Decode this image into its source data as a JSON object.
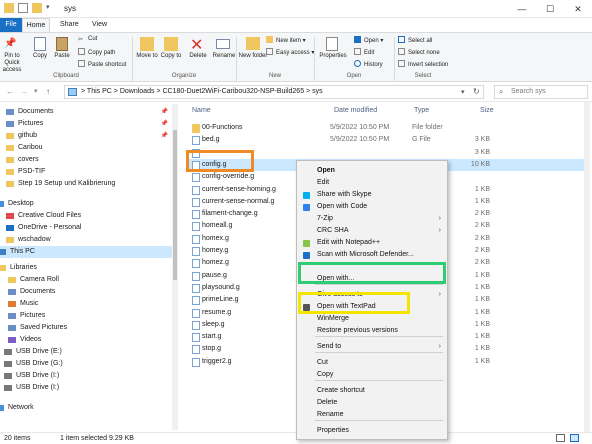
{
  "window": {
    "title": "sys",
    "minimize": "—",
    "maximize": "☐",
    "close": "✕"
  },
  "tabs": {
    "file": "File",
    "home": "Home",
    "share": "Share",
    "view": "View"
  },
  "ribbon": {
    "pin_quick": "Pin to Quick access",
    "copy": "Copy",
    "paste": "Paste",
    "cut": "Cut",
    "copy_path": "Copy path",
    "paste_shortcut": "Paste shortcut",
    "clipboard_group": "Clipboard",
    "move_to": "Move to",
    "copy_to": "Copy to",
    "delete": "Delete",
    "rename": "Rename",
    "organize_group": "Organize",
    "new_folder": "New folder",
    "new_item": "New item",
    "easy_access": "Easy access",
    "new_group": "New",
    "properties": "Properties",
    "open": "Open",
    "edit": "Edit",
    "history": "History",
    "open_group": "Open",
    "select_all": "Select all",
    "select_none": "Select none",
    "invert_selection": "Invert selection",
    "select_group": "Select"
  },
  "address": {
    "crumbs": [
      "This PC",
      "Downloads",
      "CC180-Duet2WiFi-Caribou320-NSP-Build265",
      "sys"
    ],
    "separator": ">",
    "search_placeholder": "Search sys"
  },
  "nav": {
    "items": [
      {
        "label": "Documents",
        "pinned": true
      },
      {
        "label": "Pictures",
        "pinned": true
      },
      {
        "label": "github",
        "pinned": true
      },
      {
        "label": "Caribou",
        "pinned": false
      },
      {
        "label": "covers",
        "pinned": false
      },
      {
        "label": "PSD-TIF",
        "pinned": false
      },
      {
        "label": "Step 19 Setup und Kalibrierung",
        "pinned": false
      },
      {
        "label": "Desktop",
        "pinned": false
      },
      {
        "label": "Creative Cloud Files",
        "pinned": false
      },
      {
        "label": "OneDrive - Personal",
        "pinned": false
      },
      {
        "label": "wschadow",
        "pinned": false
      },
      {
        "label": "This PC",
        "pinned": false
      },
      {
        "label": "Libraries",
        "pinned": false
      },
      {
        "label": "Camera Roll",
        "pinned": false
      },
      {
        "label": "Documents",
        "pinned": false
      },
      {
        "label": "Music",
        "pinned": false
      },
      {
        "label": "Pictures",
        "pinned": false
      },
      {
        "label": "Saved Pictures",
        "pinned": false
      },
      {
        "label": "Videos",
        "pinned": false
      },
      {
        "label": "USB Drive (E:)",
        "pinned": false
      },
      {
        "label": "USB Drive (G:)",
        "pinned": false
      },
      {
        "label": "USB Drive (I:)",
        "pinned": false
      },
      {
        "label": "USB Drive (I:)",
        "pinned": false
      },
      {
        "label": "Network",
        "pinned": false
      }
    ],
    "pin_glyph": "📌"
  },
  "columns": {
    "name": "Name",
    "date": "Date modified",
    "type": "Type",
    "size": "Size"
  },
  "files": [
    {
      "name": "00-Functions",
      "date": "5/9/2022 10:50 PM",
      "type": "File folder",
      "size": "",
      "kind": "folder"
    },
    {
      "name": "bed.g",
      "date": "5/9/2022 10:50 PM",
      "type": "G File",
      "size": "3 KB",
      "kind": "file"
    },
    {
      "name": "",
      "date": "",
      "type": "",
      "size": "3 KB",
      "kind": "file"
    },
    {
      "name": "config.g",
      "date": "",
      "type": "",
      "size": "10 KB",
      "kind": "file"
    },
    {
      "name": "config-override.g",
      "date": "",
      "type": "",
      "size": "",
      "kind": "file"
    },
    {
      "name": "current-sense-homing.g",
      "date": "",
      "type": "",
      "size": "1 KB",
      "kind": "file"
    },
    {
      "name": "current-sense-normal.g",
      "date": "",
      "type": "",
      "size": "1 KB",
      "kind": "file"
    },
    {
      "name": "filament-change.g",
      "date": "",
      "type": "",
      "size": "2 KB",
      "kind": "file"
    },
    {
      "name": "homeall.g",
      "date": "",
      "type": "",
      "size": "2 KB",
      "kind": "file"
    },
    {
      "name": "homex.g",
      "date": "",
      "type": "",
      "size": "2 KB",
      "kind": "file"
    },
    {
      "name": "homey.g",
      "date": "",
      "type": "",
      "size": "2 KB",
      "kind": "file"
    },
    {
      "name": "homez.g",
      "date": "",
      "type": "",
      "size": "2 KB",
      "kind": "file"
    },
    {
      "name": "pause.g",
      "date": "",
      "type": "",
      "size": "1 KB",
      "kind": "file"
    },
    {
      "name": "playsound.g",
      "date": "",
      "type": "",
      "size": "1 KB",
      "kind": "file"
    },
    {
      "name": "primeLine.g",
      "date": "",
      "type": "",
      "size": "1 KB",
      "kind": "file"
    },
    {
      "name": "resume.g",
      "date": "",
      "type": "",
      "size": "1 KB",
      "kind": "file"
    },
    {
      "name": "sleep.g",
      "date": "",
      "type": "",
      "size": "1 KB",
      "kind": "file"
    },
    {
      "name": "start.g",
      "date": "",
      "type": "",
      "size": "1 KB",
      "kind": "file"
    },
    {
      "name": "stop.g",
      "date": "",
      "type": "",
      "size": "1 KB",
      "kind": "file"
    },
    {
      "name": "trigger2.g",
      "date": "",
      "type": "",
      "size": "1 KB",
      "kind": "file"
    }
  ],
  "context_menu": {
    "items": [
      {
        "label": "Open",
        "bold": true,
        "icon": "",
        "arrow": false
      },
      {
        "label": "Edit",
        "bold": false,
        "icon": "",
        "arrow": false
      },
      {
        "label": "Share with Skype",
        "bold": false,
        "icon": "skype-icon",
        "arrow": false
      },
      {
        "label": "Open with Code",
        "bold": false,
        "icon": "vscode-icon",
        "arrow": false
      },
      {
        "label": "7-Zip",
        "bold": false,
        "icon": "",
        "arrow": true
      },
      {
        "label": "CRC SHA",
        "bold": false,
        "icon": "",
        "arrow": true
      },
      {
        "label": "Edit with Notepad++",
        "bold": false,
        "icon": "notepadpp-icon",
        "arrow": false
      },
      {
        "label": "Scan with Microsoft Defender...",
        "bold": false,
        "icon": "defender-icon",
        "arrow": false
      },
      {
        "label": "Open with...",
        "bold": false,
        "icon": "",
        "arrow": false
      },
      {
        "label": "Give access to",
        "bold": false,
        "icon": "",
        "arrow": true
      },
      {
        "label": "Open with TextPad",
        "bold": false,
        "icon": "textpad-icon",
        "arrow": false
      },
      {
        "label": "WinMerge",
        "bold": false,
        "icon": "",
        "arrow": false
      },
      {
        "label": "Restore previous versions",
        "bold": false,
        "icon": "",
        "arrow": false
      },
      {
        "label": "Send to",
        "bold": false,
        "icon": "",
        "arrow": true
      },
      {
        "label": "Cut",
        "bold": false,
        "icon": "",
        "arrow": false
      },
      {
        "label": "Copy",
        "bold": false,
        "icon": "",
        "arrow": false
      },
      {
        "label": "Create shortcut",
        "bold": false,
        "icon": "",
        "arrow": false
      },
      {
        "label": "Delete",
        "bold": false,
        "icon": "",
        "arrow": false
      },
      {
        "label": "Rename",
        "bold": false,
        "icon": "",
        "arrow": false
      },
      {
        "label": "Properties",
        "bold": false,
        "icon": "",
        "arrow": false
      }
    ],
    "arrow_glyph": "›"
  },
  "status": {
    "count": "20 items",
    "selected": "1 item selected  9.29 KB"
  },
  "colors": {
    "accent": "#1a6fc4",
    "highlight_orange": "#f08a24",
    "highlight_green": "#2ecc71",
    "highlight_yellow": "#f2e500",
    "selection": "#cce8ff"
  }
}
